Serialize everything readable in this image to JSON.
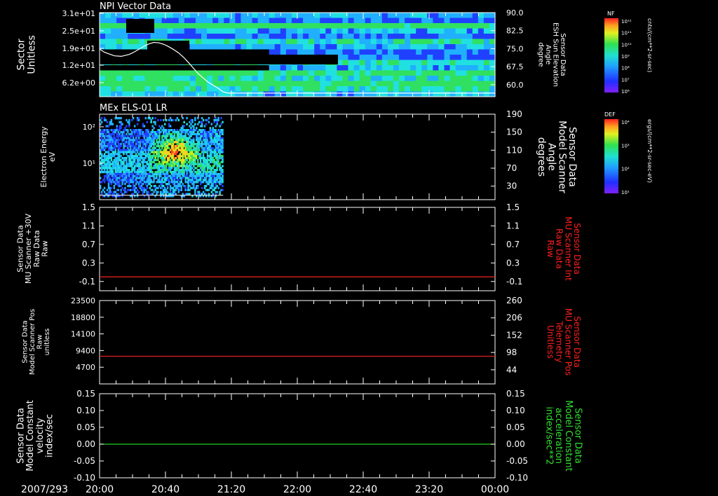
{
  "colors": {
    "background": "#000000",
    "axis": "#ffffff",
    "label_white": "#ffffff",
    "label_red": "#ff2020",
    "label_green": "#30e030",
    "line_red": "#e02020",
    "line_green": "#20d020",
    "spectrogram_colormap": [
      "#8020ff",
      "#2040ff",
      "#20b0ff",
      "#20e0e0",
      "#30e060",
      "#c0f020",
      "#ffd020",
      "#ff4020"
    ]
  },
  "chart_data": [
    {
      "id": "npi",
      "type": "heatmap",
      "title": "NPI Vector Data",
      "ylabel_left": [
        "Sector",
        "Unitless"
      ],
      "yticks_left": [
        "3.1e+01",
        "2.5e+01",
        "1.9e+01",
        "1.2e+01",
        "6.2e+00"
      ],
      "ylabel_right": [
        "Sensor Data",
        "ESH Sun Elevation",
        "Angle",
        "degree"
      ],
      "yticks_right": [
        "90.0",
        "82.5",
        "75.0",
        "67.5",
        "60.0"
      ],
      "ylim_right": [
        55,
        90
      ],
      "overlay_line": {
        "color": "#ffffff",
        "x": [
          0.0,
          0.05,
          0.15,
          0.22,
          0.3,
          0.35,
          0.4,
          0.45,
          0.5,
          0.55,
          0.6,
          0.65,
          0.7,
          0.75,
          0.8,
          0.85,
          0.9,
          0.95,
          1.0,
          1.1,
          1.2,
          1.25,
          1.3,
          1.4,
          1.5,
          2.0,
          3.0,
          4.0
        ],
        "y": [
          74.8,
          73.5,
          72.0,
          71.8,
          72.6,
          73.6,
          74.8,
          76.0,
          77.0,
          77.6,
          77.4,
          76.8,
          75.8,
          74.6,
          73.2,
          71.4,
          69.2,
          66.8,
          64.5,
          61.0,
          58.5,
          57.0,
          56.5,
          56.5,
          56.5,
          56.5,
          56.5,
          56.5
        ]
      },
      "colorbar": {
        "label": "NF",
        "unit": "cnts/(cm**2-sr-sec)",
        "ticks": [
          "10¹²",
          "10¹¹",
          "10¹⁰",
          "10⁹",
          "10⁸",
          "10⁷",
          "10⁶"
        ]
      }
    },
    {
      "id": "els",
      "type": "heatmap",
      "title": "MEx ELS-01 LR",
      "ylabel_left": [
        "Electron Energy",
        "eV"
      ],
      "yticks_left": [
        "10²",
        "10¹"
      ],
      "ylabel_right": [
        "Sensor Data",
        "Model Scanner",
        "Angle",
        "degrees"
      ],
      "yticks_right": [
        "190",
        "150",
        "110",
        "70",
        "30"
      ],
      "ylim_right": [
        0,
        190
      ],
      "data_end_hours": 1.25,
      "overlay_line": {
        "color": "#ffffff",
        "x": [
          0,
          1.25
        ],
        "y": [
          10,
          10
        ]
      },
      "colorbar": {
        "label": "DEF",
        "unit": "ergs/(cm**2-sr-sec-eV)",
        "ticks": [
          "10⁴",
          "10³",
          "10²",
          "10¹"
        ]
      }
    },
    {
      "id": "mu_raw",
      "type": "line",
      "ylabel_left": [
        "Sensor Data",
        "MU Scanner +30V",
        "Raw Data",
        "Raw"
      ],
      "yticks_left": [
        "1.5",
        "1.1",
        "0.7",
        "0.3",
        "-0.1"
      ],
      "ylabel_right": [
        "Sensor Data",
        "MU Scanner Int",
        "Raw Data",
        "Raw"
      ],
      "yticks_right": [
        "1.5",
        "1.1",
        "0.7",
        "0.3",
        "-0.1"
      ],
      "right_label_color": "#ff2020",
      "ylim": [
        -0.3,
        1.5
      ],
      "line_color": "#e02020",
      "series": [
        {
          "x": [
            0,
            4
          ],
          "y": [
            0.0,
            0.0
          ]
        }
      ]
    },
    {
      "id": "mu_pos",
      "type": "line",
      "ylabel_left": [
        "Sensor Data",
        "Model Scanner Pos",
        "Raw",
        "unitless"
      ],
      "yticks_left": [
        "23500",
        "18800",
        "14100",
        "9400",
        "4700"
      ],
      "ylabel_right": [
        "Sensor Data",
        "MU Scanner Pos",
        "Telemetry",
        "Unitless"
      ],
      "yticks_right": [
        "260",
        "206",
        "152",
        "98",
        "44"
      ],
      "right_label_color": "#ff2020",
      "ylim": [
        0,
        23500
      ],
      "line_color": "#e02020",
      "series": [
        {
          "x": [
            0,
            4
          ],
          "y": [
            7800,
            7800
          ]
        }
      ]
    },
    {
      "id": "const",
      "type": "line",
      "ylabel_left": [
        "Sensor Data",
        "Model Constant",
        "velocity",
        "index/sec"
      ],
      "yticks_left": [
        "0.15",
        "0.10",
        "0.05",
        "0.00",
        "-0.05",
        "-0.10"
      ],
      "ylabel_right": [
        "Sensor Data",
        "Model Constant",
        "acceleration",
        "index/sec**2"
      ],
      "yticks_right": [
        "0.15",
        "0.10",
        "0.05",
        "0.00",
        "-0.05",
        "-0.10"
      ],
      "right_label_color": "#30e030",
      "ylim": [
        -0.1,
        0.15
      ],
      "line_color": "#20d020",
      "series": [
        {
          "x": [
            0,
            4
          ],
          "y": [
            0.0,
            0.0
          ]
        }
      ]
    }
  ],
  "x_axis": {
    "date_label": "2007/293",
    "ticks": [
      "20:00",
      "20:40",
      "21:20",
      "22:00",
      "22:40",
      "23:20",
      "00:00"
    ],
    "range_hours": [
      0,
      4
    ]
  }
}
